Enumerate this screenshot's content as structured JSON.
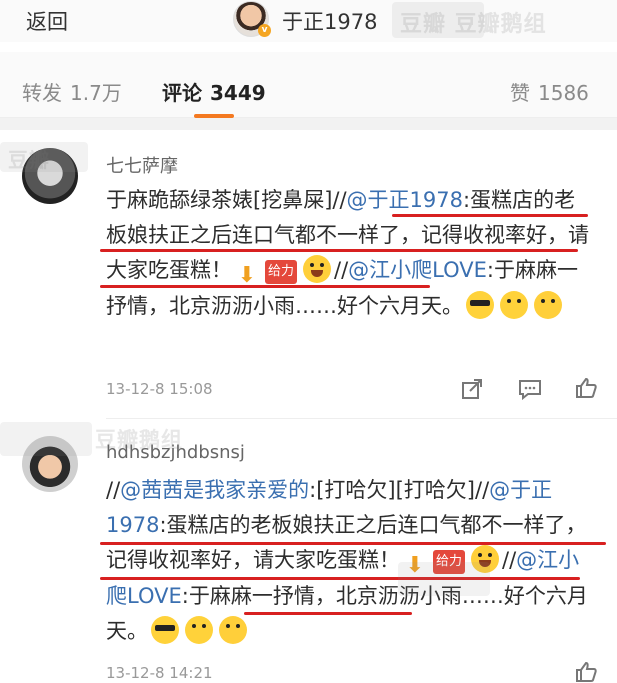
{
  "header": {
    "back_label": "返回",
    "title": "于正1978",
    "verified_badge": "v",
    "watermark": "豆瓣 豆瓣鹅组"
  },
  "tabs": [
    {
      "label": "转发",
      "count": "1.7万"
    },
    {
      "label": "评论",
      "count": "3449"
    },
    {
      "label": "赞",
      "count": "1586"
    }
  ],
  "comments": [
    {
      "username": "七七萨摩",
      "watermark": "豆瓣",
      "content": {
        "p1": "于麻跪舔绿茶婊[挖鼻屎]//",
        "m1": "@于正1978",
        "p2": ":蛋糕店的老板娘扶正之后连口气都不一样了，记得收视率好，请大家吃蛋糕！",
        "tag": "给力",
        "p3": "//",
        "m2": "@江小爬LOVE",
        "p4": ":于麻麻一抒情，北京沥沥小雨……好个六月天。"
      },
      "time": "13-12-8 15:08"
    },
    {
      "username": "hdhsbzjhdbsnsj",
      "watermark": "豆瓣鹅组",
      "content": {
        "p0": "//",
        "m0": "@茜茜是我家亲爱的",
        "p1": ":[打哈欠][打哈欠]//",
        "m1": "@于正1978",
        "p2": ":蛋糕店的老板娘扶正之后连口气都不一样了，记得收视率好，请大家吃蛋糕！",
        "tag": "给力",
        "p3": "//",
        "m2": "@江小爬LOVE",
        "p4": ":于麻麻一抒情，北京沥沥小雨……好个六月天。"
      },
      "time": "13-12-8 14:21"
    }
  ],
  "icons": [
    "share-icon",
    "comment-icon",
    "like-icon"
  ],
  "colors": {
    "accent": "#f47920",
    "mention": "#3a6fb0",
    "annotation": "#d82020"
  }
}
